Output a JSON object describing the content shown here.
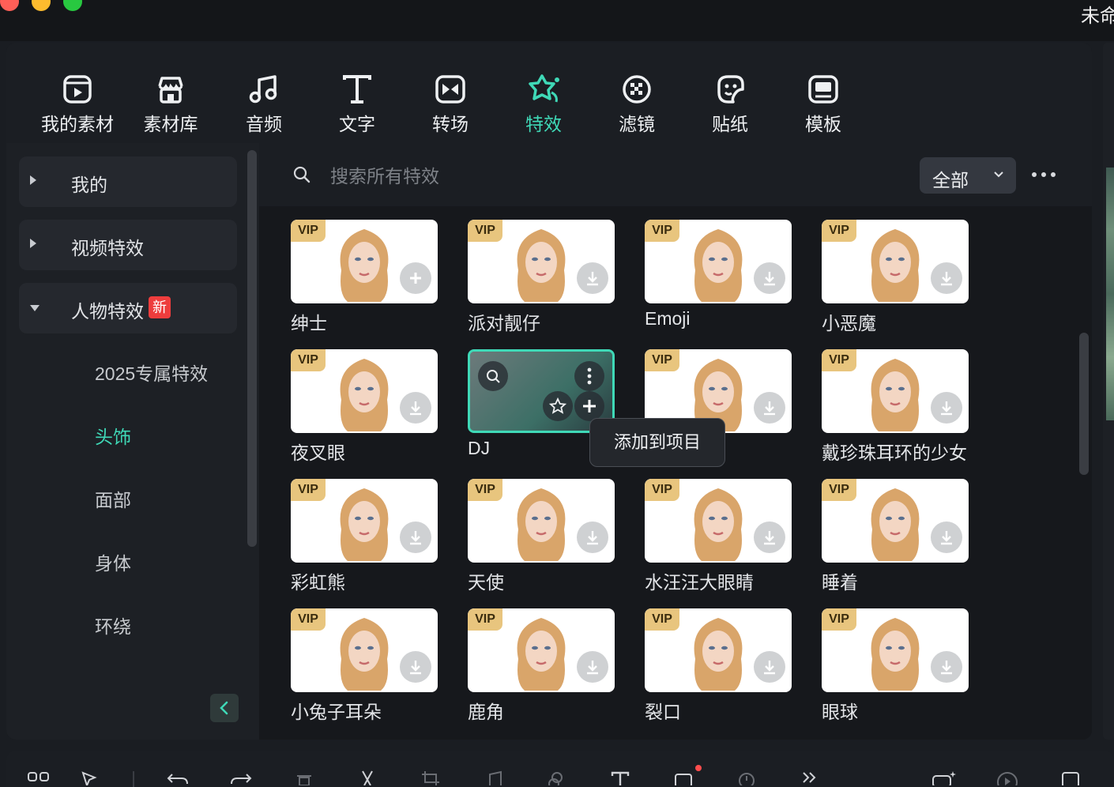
{
  "window": {
    "title": "未命"
  },
  "nav": {
    "tabs": [
      {
        "label": "我的素材",
        "icon": "media-icon"
      },
      {
        "label": "素材库",
        "icon": "store-icon"
      },
      {
        "label": "音频",
        "icon": "music-icon"
      },
      {
        "label": "文字",
        "icon": "text-icon"
      },
      {
        "label": "转场",
        "icon": "transition-icon"
      },
      {
        "label": "特效",
        "icon": "effects-icon",
        "active": true
      },
      {
        "label": "滤镜",
        "icon": "filter-icon"
      },
      {
        "label": "贴纸",
        "icon": "sticker-icon"
      },
      {
        "label": "模板",
        "icon": "template-icon"
      }
    ]
  },
  "sidebar": {
    "categories": [
      {
        "label": "我的",
        "expanded": false
      },
      {
        "label": "视频特效",
        "expanded": false
      },
      {
        "label": "人物特效",
        "expanded": true,
        "badge": "新"
      }
    ],
    "subitems": [
      {
        "label": "2025专属特效"
      },
      {
        "label": "头饰",
        "active": true
      },
      {
        "label": "面部"
      },
      {
        "label": "身体"
      },
      {
        "label": "环绕"
      }
    ]
  },
  "search": {
    "placeholder": "搜索所有特效"
  },
  "filter": {
    "selected": "全部"
  },
  "badge_label": "VIP",
  "effects": [
    {
      "name": "绅士",
      "vip": true,
      "action": "add"
    },
    {
      "name": "派对靓仔",
      "vip": true,
      "action": "download"
    },
    {
      "name": "Emoji",
      "vip": true,
      "action": "download"
    },
    {
      "name": "小恶魔",
      "vip": true,
      "action": "download"
    },
    {
      "name": "夜叉眼",
      "vip": true,
      "action": "download"
    },
    {
      "name": "DJ",
      "vip": false,
      "action": "add",
      "selected": true
    },
    {
      "name": "",
      "vip": true,
      "action": "download"
    },
    {
      "name": "戴珍珠耳环的少女",
      "vip": true,
      "action": "download"
    },
    {
      "name": "彩虹熊",
      "vip": true,
      "action": "download"
    },
    {
      "name": "天使",
      "vip": true,
      "action": "download"
    },
    {
      "name": "水汪汪大眼睛",
      "vip": true,
      "action": "download"
    },
    {
      "name": "睡着",
      "vip": true,
      "action": "download"
    },
    {
      "name": "小兔子耳朵",
      "vip": true,
      "action": "download"
    },
    {
      "name": "鹿角",
      "vip": true,
      "action": "download"
    },
    {
      "name": "裂口",
      "vip": true,
      "action": "download"
    },
    {
      "name": "眼球",
      "vip": true,
      "action": "download"
    }
  ],
  "tooltip": {
    "text": "添加到项目"
  },
  "colors": {
    "accent": "#3fd9b7",
    "vip": "#e8c57e",
    "badge_new": "#ee3d3d"
  }
}
